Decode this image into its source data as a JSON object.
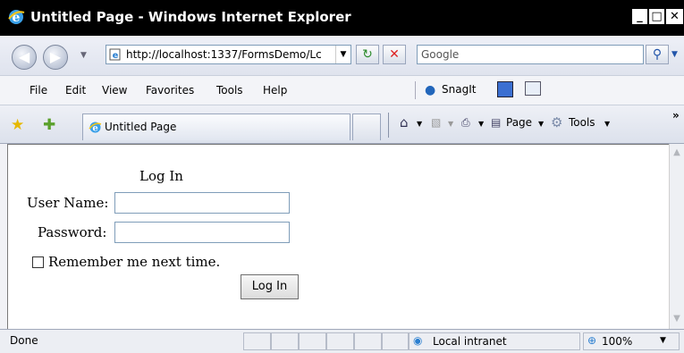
{
  "window": {
    "title": "Untitled Page - Windows Internet Explorer",
    "min": "_",
    "max": "□",
    "close": "✕"
  },
  "nav": {
    "address": "http://localhost:1337/FormsDemo/Lc",
    "search_placeholder": "Google"
  },
  "menu": [
    "File",
    "Edit",
    "View",
    "Favorites",
    "Tools",
    "Help"
  ],
  "toolbar": {
    "snagit": "SnagIt"
  },
  "tab": {
    "label": "Untitled Page"
  },
  "commands": {
    "page": "Page",
    "tools": "Tools"
  },
  "login": {
    "title": "Log In",
    "username_label": "User Name:",
    "password_label": "Password:",
    "remember_label": "Remember me next time.",
    "button": "Log In"
  },
  "status": {
    "text": "Done",
    "zone": "Local intranet",
    "zoom": "100%"
  },
  "colors": {
    "titlebar": "#000000",
    "chrome": "#f1f2f6"
  }
}
